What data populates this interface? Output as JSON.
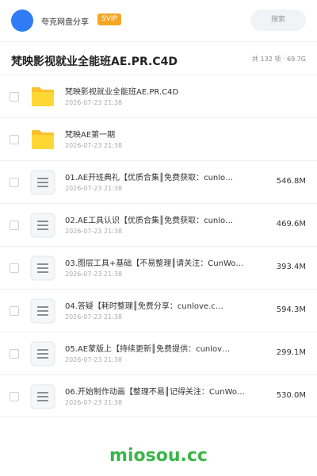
{
  "header": {
    "user_name": "夸克网盘分享",
    "badge": "SVIP",
    "search_placeholder": "搜索"
  },
  "folder": {
    "title": "梵映影视就业全能班AE.PR.C4D",
    "summary": "共 132 项 · 69.7G"
  },
  "items": [
    {
      "type": "folder",
      "name": "梵映影视就业全能班AE.PR.C4D",
      "date": "2026-07-23 21:38",
      "size": ""
    },
    {
      "type": "folder",
      "name": "梵映AE第一期",
      "date": "2026-07-23 21:38",
      "size": ""
    },
    {
      "type": "file",
      "name": "01.AE开班典礼【优质合集║免费获取：cunlo…",
      "date": "2026-07-23 21:38",
      "size": "546.8M"
    },
    {
      "type": "file",
      "name": "02.AE工具认识【优质合集║免费获取：cunlo…",
      "date": "2026-07-23 21:38",
      "size": "469.6M"
    },
    {
      "type": "file",
      "name": "03.图层工具+基础【不易整理║请关注：CunWo…",
      "date": "2026-07-23 21:38",
      "size": "393.4M"
    },
    {
      "type": "file",
      "name": "04.答疑【耗时整理║免费分享：cunlove.c…",
      "date": "2026-07-23 21:38",
      "size": "594.3M"
    },
    {
      "type": "file",
      "name": "05.AE蒙版上【持续更新║免费提供：cunlov…",
      "date": "2026-07-23 21:38",
      "size": "299.1M"
    },
    {
      "type": "file",
      "name": "06.开始制作动画【整理不易║记得关注：CunWo…",
      "date": "2026-07-23 21:38",
      "size": "530.0M"
    }
  ],
  "icons": {
    "folder": "folder-icon",
    "file": "document-icon"
  },
  "colors": {
    "accent": "#2f7cf6",
    "svip": "#f5a623",
    "folder": "#fbc02d",
    "watermark": "#3ab54a"
  },
  "watermark": "miosou.cc"
}
